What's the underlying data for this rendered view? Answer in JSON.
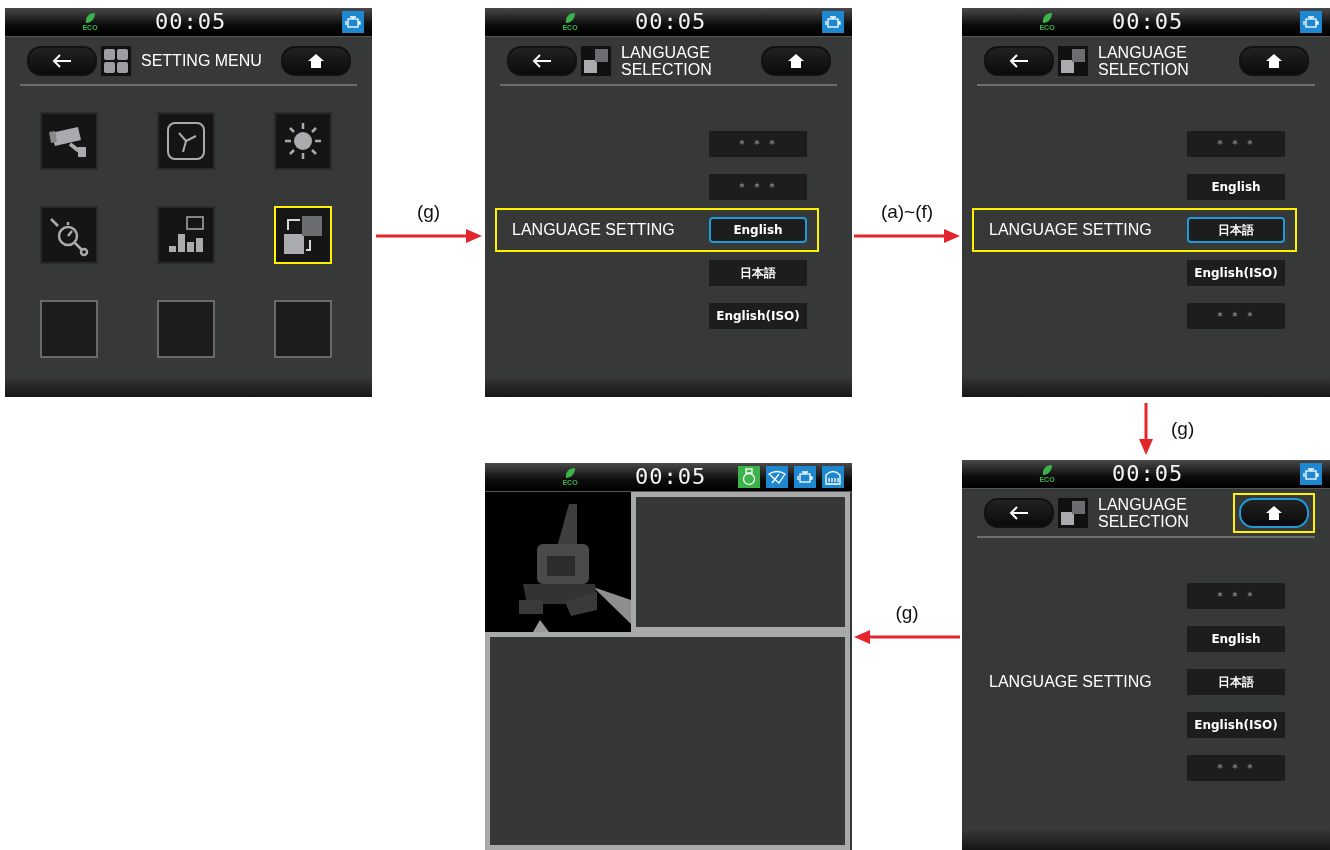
{
  "screens": [
    {
      "kind": "menu",
      "status": {
        "eco": "ECO",
        "time": "00:05",
        "icons": [
          {
            "kind": "engine",
            "color": "#1d87cf"
          }
        ]
      },
      "header": {
        "title": "SETTING MENU",
        "home_highlighted": false
      },
      "tiles": [
        {
          "kind": "camera",
          "highlighted": false
        },
        {
          "kind": "clock",
          "highlighted": false
        },
        {
          "kind": "brightness",
          "highlighted": false
        },
        {
          "kind": "maintenance",
          "highlighted": false
        },
        {
          "kind": "meter",
          "highlighted": false
        },
        {
          "kind": "language",
          "highlighted": true
        },
        {
          "kind": "empty",
          "highlighted": false
        },
        {
          "kind": "empty",
          "highlighted": false
        },
        {
          "kind": "empty",
          "highlighted": false
        }
      ]
    },
    {
      "kind": "language",
      "status": {
        "eco": "ECO",
        "time": "00:05",
        "icons": [
          {
            "kind": "engine",
            "color": "#1d87cf"
          }
        ]
      },
      "header": {
        "title": "LANGUAGE SELECTION",
        "home_highlighted": false
      },
      "setting_label": "LANGUAGE SETTING",
      "row_highlighted": true,
      "options": [
        {
          "kind": "unset",
          "text": "＊＊＊",
          "selected": false
        },
        {
          "kind": "unset",
          "text": "＊＊＊",
          "selected": false
        },
        {
          "kind": "language",
          "text": "English",
          "selected": true
        },
        {
          "kind": "language",
          "text": "日本語",
          "selected": false
        },
        {
          "kind": "language",
          "text": "English(ISO)",
          "selected": false
        }
      ]
    },
    {
      "kind": "language",
      "status": {
        "eco": "ECO",
        "time": "00:05",
        "icons": [
          {
            "kind": "engine",
            "color": "#1d87cf"
          }
        ]
      },
      "header": {
        "title": "LANGUAGE SELECTION",
        "home_highlighted": false
      },
      "setting_label": "LANGUAGE SETTING",
      "row_highlighted": true,
      "options": [
        {
          "kind": "unset",
          "text": "＊＊＊",
          "selected": false
        },
        {
          "kind": "language",
          "text": "English",
          "selected": false
        },
        {
          "kind": "language",
          "text": "日本語",
          "selected": true
        },
        {
          "kind": "language",
          "text": "English(ISO)",
          "selected": false
        },
        {
          "kind": "unset",
          "text": "＊＊＊",
          "selected": false
        }
      ]
    },
    {
      "kind": "home",
      "status": {
        "eco": "ECO",
        "time": "00:05",
        "icons": [
          {
            "kind": "canister",
            "color": "#3cb44a"
          },
          {
            "kind": "wiper",
            "color": "#1d87cf"
          },
          {
            "kind": "engine",
            "color": "#1d87cf"
          },
          {
            "kind": "tank",
            "color": "#1d87cf"
          }
        ]
      }
    },
    {
      "kind": "language",
      "status": {
        "eco": "ECO",
        "time": "00:05",
        "icons": [
          {
            "kind": "engine",
            "color": "#1d87cf"
          }
        ]
      },
      "header": {
        "title": "LANGUAGE SELECTION",
        "home_highlighted": true
      },
      "setting_label": "LANGUAGE SETTING",
      "row_highlighted": false,
      "options": [
        {
          "kind": "unset",
          "text": "＊＊＊",
          "selected": false
        },
        {
          "kind": "language",
          "text": "English",
          "selected": false
        },
        {
          "kind": "language",
          "text": "日本語",
          "selected": false
        },
        {
          "kind": "language",
          "text": "English(ISO)",
          "selected": false
        },
        {
          "kind": "unset",
          "text": "＊＊＊",
          "selected": false
        }
      ]
    }
  ],
  "transitions": [
    {
      "label": "(g)"
    },
    {
      "label": "(a)~(f)"
    },
    {
      "label": "(g)"
    },
    {
      "label": "(g)"
    }
  ]
}
